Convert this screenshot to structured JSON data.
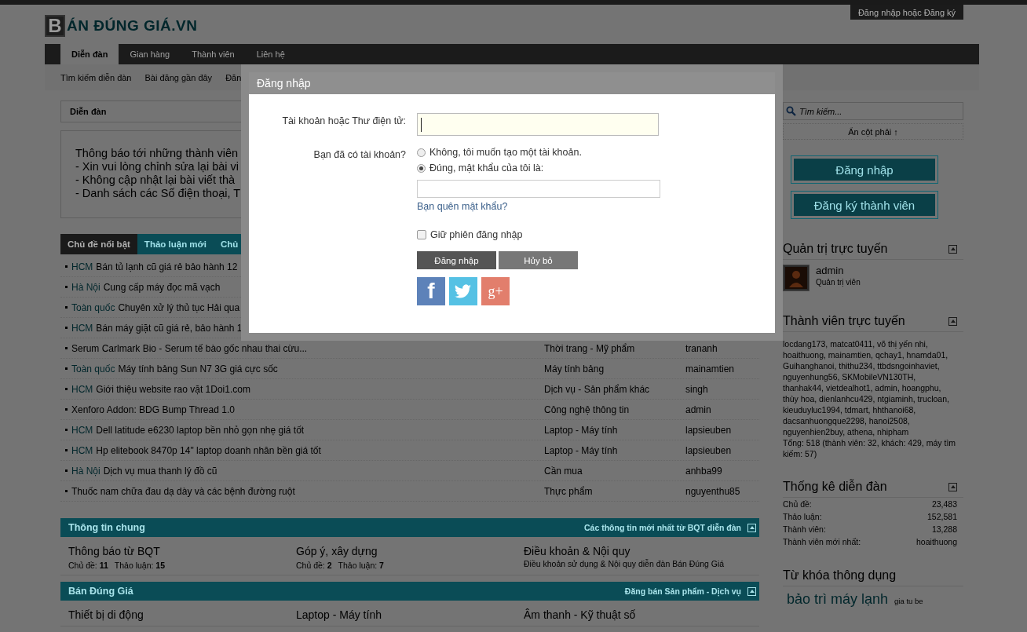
{
  "header": {
    "logo_mark": "B",
    "logo_text": "ÁN ĐÚNG GIÁ",
    "logo_suffix": ".VN",
    "account_link": "Đăng nhập hoặc Đăng ký"
  },
  "nav": {
    "tabs": [
      {
        "label": "Diễn đàn",
        "selected": true
      },
      {
        "label": "Gian hàng",
        "selected": false
      },
      {
        "label": "Thành viên",
        "selected": false
      },
      {
        "label": "Liên hệ",
        "selected": false
      }
    ],
    "sub_links": [
      "Tìm kiếm diễn đàn",
      "Bài đăng gần đây",
      "Đăn"
    ]
  },
  "breadcrumb": [
    "Diễn đàn"
  ],
  "notice": [
    "Thông báo tới những thành viên",
    "- Xin vui lòng chỉnh sửa lại bài vi",
    "- Không cập nhật lại bài viết thà",
    "- Danh sách các Số điện thoại, T"
  ],
  "thread_tabs": [
    {
      "label": "Chủ đề nổi bật",
      "selected": true
    },
    {
      "label": "Thảo luận mới",
      "selected": false
    },
    {
      "label": "Chủ",
      "selected": false
    }
  ],
  "threads": [
    {
      "prefix": "HCM",
      "title": "Bán tủ lạnh cũ giá rẻ bảo hành 12"
    },
    {
      "prefix": "Hà Nội",
      "title": "Cung cấp máy đọc mã vạch"
    },
    {
      "prefix": "Toàn quốc",
      "title": "Chuyên xử lý thủ tục Hải qua"
    },
    {
      "prefix": "HCM",
      "title": "Bán máy giặt cũ giá rẻ, bảo hành 1"
    },
    {
      "title": "Serum Carlmark Bio - Serum tế bào gốc nhau thai cừu...",
      "category": "Thời trang - Mỹ phẩm",
      "author": "trananh"
    },
    {
      "prefix": "Toàn quốc",
      "title": "Máy tính bảng Sun N7 3G giá cực sốc",
      "category": "Máy tính bảng",
      "author": "mainamtien"
    },
    {
      "prefix": "HCM",
      "title": "Giới thiệu website rao vặt 1Doi1.com",
      "category": "Dịch vụ - Sản phẩm khác",
      "author": "singh"
    },
    {
      "title": "Xenforo Addon: BDG Bump Thread 1.0",
      "category": "Công nghệ thông tin",
      "author": "admin"
    },
    {
      "prefix": "HCM",
      "title": "Dell latitude e6230 laptop bền nhỏ gọn nhẹ giá tốt",
      "category": "Laptop - Máy tính",
      "author": "lapsieuben"
    },
    {
      "prefix": "HCM",
      "title": "Hp elitebook 8470p 14\" laptop doanh nhân bền giá tốt",
      "category": "Laptop - Máy tính",
      "author": "lapsieuben"
    },
    {
      "prefix": "Hà Nội",
      "title": "Dịch vụ mua thanh lý đồ cũ",
      "category": "Cần mua",
      "author": "anhba99"
    },
    {
      "title": "Thuốc nam chữa đau dạ dày và các bệnh đường ruột",
      "category": "Thực phẩm",
      "author": "nguyenthu85"
    }
  ],
  "sections": [
    {
      "title": "Thông tin chung",
      "description": "Các thông tin mới nhất từ BQT diễn đàn",
      "forums": [
        {
          "name": "Thông báo từ BQT",
          "stats": [
            "Chủ đề: **11**",
            "Thảo luận: **15**"
          ]
        },
        {
          "name": "Góp ý, xây dựng",
          "stats": [
            "Chủ đề: **2**",
            "Thảo luận: **7**"
          ]
        },
        {
          "name": "Điều khoản & Nội quy",
          "description": "Điều khoản sử dụng & Nội quy diễn đàn Bán Đúng Giá"
        }
      ]
    },
    {
      "title": "Bán Đúng Giá",
      "description": "Đăng bán Sản phẩm - Dịch vụ",
      "forums": [
        {
          "name": "Thiết bị di động"
        },
        {
          "name": "Laptop - Máy tính"
        },
        {
          "name": "Âm thanh - Kỹ thuật số"
        }
      ]
    }
  ],
  "sidebar": {
    "search": {
      "placeholder": "Tìm kiếm..."
    },
    "hide_link": "Ẩn cột phải ↑",
    "buttons": [
      "Đăng nhập",
      "Đăng ký thành viên"
    ],
    "staff": {
      "title": "Quản trị trực tuyến",
      "name": "admin",
      "role": "Quản trị viên"
    },
    "online": {
      "title": "Thành viên trực tuyến",
      "members": "locdang173, matcat0411, võ thị yến nhi, hoaithuong, mainamtien, qchay1, hnamda01, Guihanghanoi, thithu234, ttbdsngoinhaviet, nguyenhung56, SKMobileVN130TH, thanhak44, vietdealhot1, admin, hoangphu, thùy hoa, dienlanhcu429, ntgiaminh, trucloan, kieuduyluc1994, tdmart, hhthanoi68, dacsanhuongque2298, hanoi2508, nguyenhien2buy, athena, nhipham",
      "total": "Tổng: 518 (thành viên: 32, khách: 429, máy tìm kiếm: 57)"
    },
    "stats": {
      "title": "Thống kê diễn đàn",
      "rows": [
        {
          "label": "Chủ đề:",
          "value": "23,483"
        },
        {
          "label": "Thảo luận:",
          "value": "152,581"
        },
        {
          "label": "Thành viên:",
          "value": "13,288"
        },
        {
          "label": "Thành viên mới nhất:",
          "value": "hoaithuong"
        }
      ]
    },
    "keywords": {
      "title": "Từ khóa thông dụng",
      "tags": [
        {
          "label": "bảo trì máy lạnh",
          "kind": "large"
        },
        {
          "label": "gia tu be",
          "kind": "small"
        }
      ]
    }
  },
  "login": {
    "title": "Đăng nhập",
    "account_label": "Tài khoản hoặc Thư điện tử:",
    "account_focused": true,
    "have_account_label": "Bạn đã có tài khoản?",
    "options": [
      {
        "label": "Không, tôi muốn tạo một tài khoản.",
        "selected": false
      },
      {
        "label": "Đúng, mật khẩu của tôi là:",
        "selected": true
      }
    ],
    "forgot_link": "Bạn quên mật khẩu?",
    "remember": {
      "label": "Giữ phiên đăng nhập",
      "checked": false
    },
    "buttons": [
      "Đăng nhập",
      "Hủy bỏ"
    ],
    "social": [
      {
        "kind": "facebook",
        "glyph": "f"
      },
      {
        "kind": "twitter"
      },
      {
        "kind": "google",
        "glyph": "g+"
      }
    ]
  }
}
